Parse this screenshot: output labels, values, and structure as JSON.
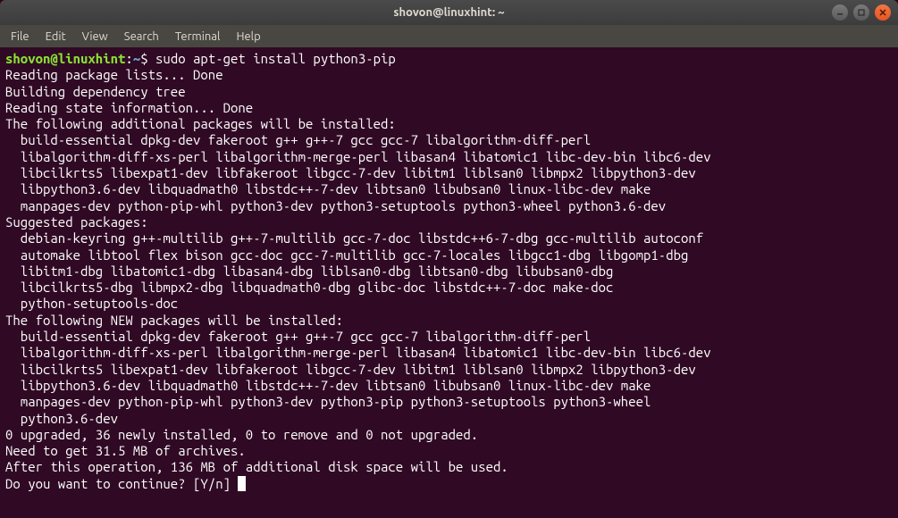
{
  "window": {
    "title": "shovon@linuxhint: ~"
  },
  "menubar": {
    "items": [
      "File",
      "Edit",
      "View",
      "Search",
      "Terminal",
      "Help"
    ]
  },
  "terminal": {
    "prompt_user": "shovon@linuxhint",
    "prompt_path": "~",
    "command": "sudo apt-get install python3-pip",
    "output_lines": [
      "Reading package lists... Done",
      "Building dependency tree       ",
      "Reading state information... Done",
      "The following additional packages will be installed:",
      "  build-essential dpkg-dev fakeroot g++ g++-7 gcc gcc-7 libalgorithm-diff-perl",
      "  libalgorithm-diff-xs-perl libalgorithm-merge-perl libasan4 libatomic1 libc-dev-bin libc6-dev",
      "  libcilkrts5 libexpat1-dev libfakeroot libgcc-7-dev libitm1 liblsan0 libmpx2 libpython3-dev",
      "  libpython3.6-dev libquadmath0 libstdc++-7-dev libtsan0 libubsan0 linux-libc-dev make",
      "  manpages-dev python-pip-whl python3-dev python3-setuptools python3-wheel python3.6-dev",
      "Suggested packages:",
      "  debian-keyring g++-multilib g++-7-multilib gcc-7-doc libstdc++6-7-dbg gcc-multilib autoconf",
      "  automake libtool flex bison gcc-doc gcc-7-multilib gcc-7-locales libgcc1-dbg libgomp1-dbg",
      "  libitm1-dbg libatomic1-dbg libasan4-dbg liblsan0-dbg libtsan0-dbg libubsan0-dbg",
      "  libcilkrts5-dbg libmpx2-dbg libquadmath0-dbg glibc-doc libstdc++-7-doc make-doc",
      "  python-setuptools-doc",
      "The following NEW packages will be installed:",
      "  build-essential dpkg-dev fakeroot g++ g++-7 gcc gcc-7 libalgorithm-diff-perl",
      "  libalgorithm-diff-xs-perl libalgorithm-merge-perl libasan4 libatomic1 libc-dev-bin libc6-dev",
      "  libcilkrts5 libexpat1-dev libfakeroot libgcc-7-dev libitm1 liblsan0 libmpx2 libpython3-dev",
      "  libpython3.6-dev libquadmath0 libstdc++-7-dev libtsan0 libubsan0 linux-libc-dev make",
      "  manpages-dev python-pip-whl python3-dev python3-pip python3-setuptools python3-wheel",
      "  python3.6-dev",
      "0 upgraded, 36 newly installed, 0 to remove and 0 not upgraded.",
      "Need to get 31.5 MB of archives.",
      "After this operation, 136 MB of additional disk space will be used.",
      "Do you want to continue? [Y/n] "
    ]
  }
}
